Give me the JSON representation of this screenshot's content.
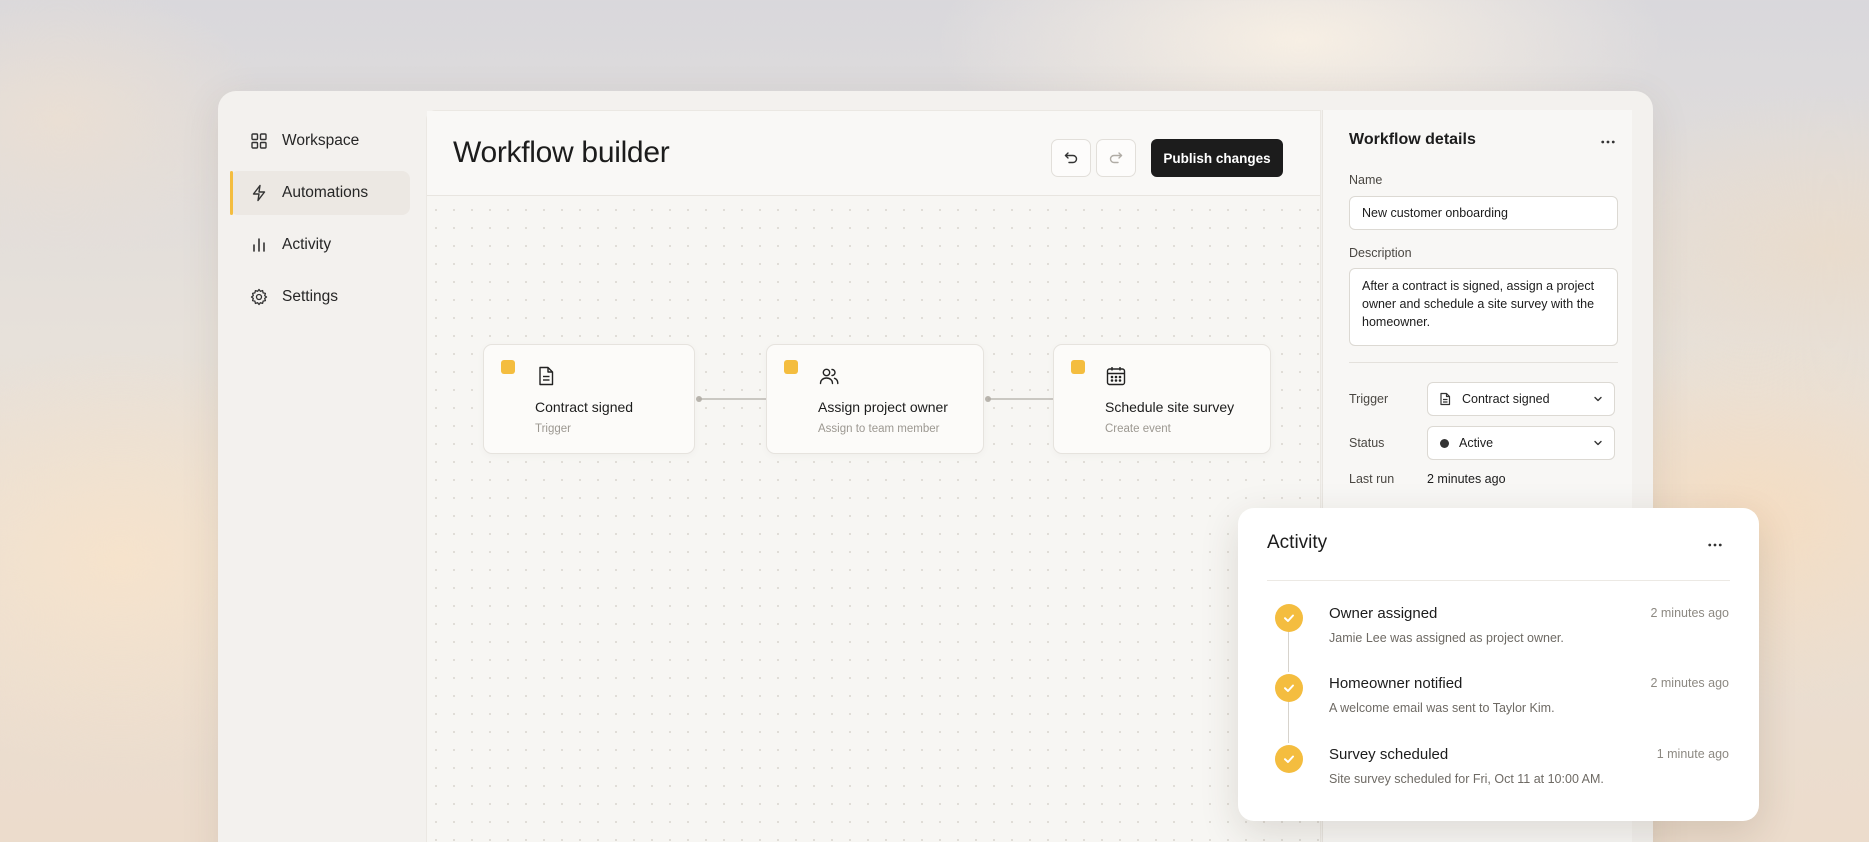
{
  "sidebar": {
    "items": [
      {
        "label": "Workspace",
        "icon": "grid-icon"
      },
      {
        "label": "Automations",
        "icon": "lightning-icon",
        "active": true
      },
      {
        "label": "Activity",
        "icon": "bar-chart-icon"
      },
      {
        "label": "Settings",
        "icon": "gear-icon"
      }
    ]
  },
  "header": {
    "title": "Workflow builder",
    "publish_label": "Publish changes"
  },
  "workflow": {
    "nodes": [
      {
        "title": "Contract signed",
        "subtitle": "Trigger",
        "icon": "document-icon"
      },
      {
        "title": "Assign project owner",
        "subtitle": "Assign to team member",
        "icon": "users-icon"
      },
      {
        "title": "Schedule site survey",
        "subtitle": "Create event",
        "icon": "calendar-icon"
      }
    ]
  },
  "details": {
    "title": "Workflow details",
    "name_label": "Name",
    "name_value": "New customer onboarding",
    "description_label": "Description",
    "description_value": "After a contract is signed, assign a project owner and schedule a site survey with the homeowner.",
    "trigger_label": "Trigger",
    "trigger_value": "Contract signed",
    "status_label": "Status",
    "status_value": "Active",
    "last_run_label": "Last run",
    "last_run_value": "2 minutes ago"
  },
  "activity": {
    "title": "Activity",
    "items": [
      {
        "title": "Owner assigned",
        "description": "Jamie Lee was assigned as project owner.",
        "time": "2 minutes ago"
      },
      {
        "title": "Homeowner notified",
        "description": "A welcome email was sent to Taylor Kim.",
        "time": "2 minutes ago"
      },
      {
        "title": "Survey scheduled",
        "description": "Site survey scheduled for Fri, Oct 11 at 10:00 AM.",
        "time": "1 minute ago"
      }
    ]
  },
  "colors": {
    "accent": "#f4bd3f",
    "primary_button": "#1c1c1c",
    "app_background": "#f3f1ee"
  }
}
